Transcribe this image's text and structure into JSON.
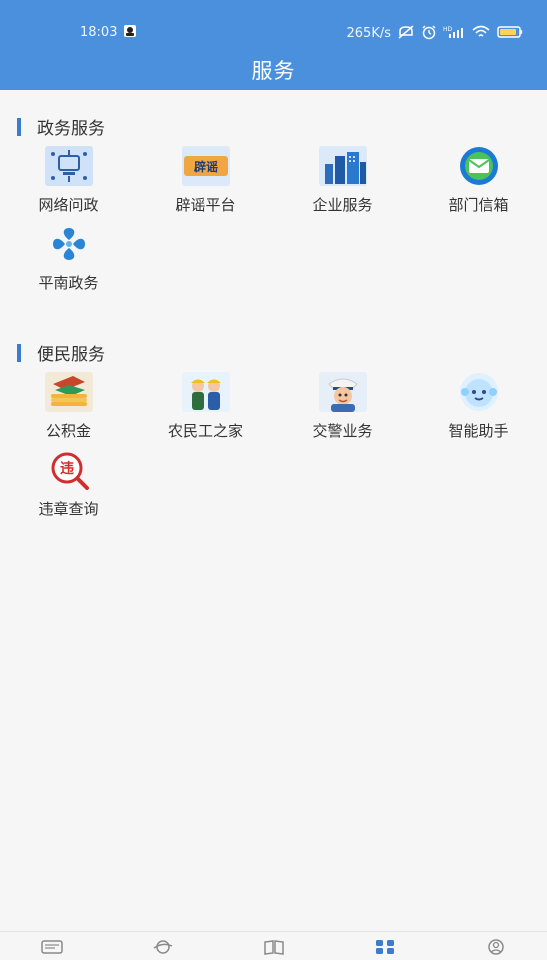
{
  "status": {
    "time": "18:03",
    "speed": "265K/s",
    "icons": [
      "avatar-icon",
      "mute-icon",
      "alarm-icon",
      "hd-signal-icon",
      "wifi-icon",
      "battery-icon"
    ]
  },
  "header": {
    "title": "服务"
  },
  "sections": [
    {
      "title": "政务服务",
      "items": [
        {
          "label": "网络问政",
          "icon": "network-politics-icon"
        },
        {
          "label": "辟谣平台",
          "icon": "rumor-platform-icon"
        },
        {
          "label": "企业服务",
          "icon": "enterprise-icon"
        },
        {
          "label": "部门信箱",
          "icon": "mailbox-icon"
        },
        {
          "label": "平南政务",
          "icon": "pingnan-icon"
        }
      ]
    },
    {
      "title": "便民服务",
      "items": [
        {
          "label": "公积金",
          "icon": "provident-fund-icon"
        },
        {
          "label": "农民工之家",
          "icon": "migrant-workers-icon"
        },
        {
          "label": "交警业务",
          "icon": "traffic-police-icon"
        },
        {
          "label": "智能助手",
          "icon": "ai-assistant-icon"
        },
        {
          "label": "违章查询",
          "icon": "violation-query-icon"
        }
      ]
    }
  ],
  "colors": {
    "accent": "#4a90dd",
    "section_bar": "#3b7bd0",
    "page_bg": "#f6f6f6"
  }
}
